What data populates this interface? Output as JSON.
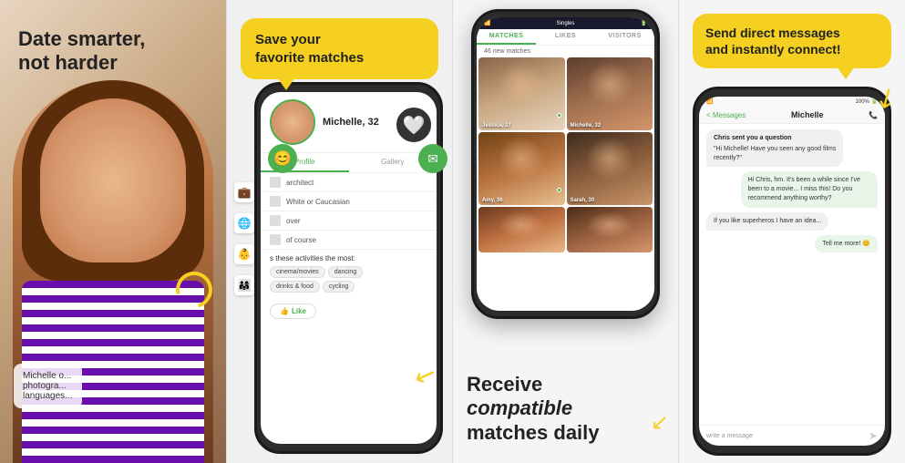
{
  "panel1": {
    "headline1": "Date smarter,",
    "headline2": "not harder",
    "info_name": "Michelle o...",
    "info_photos": "photogra...",
    "info_languages": "languages..."
  },
  "panel2": {
    "bubble_text_1": "Save your",
    "bubble_text_2": "favorite",
    "bubble_text_3": "matches",
    "profile_name": "Michelle, 32",
    "tab_profile": "Profile",
    "tab_gallery": "Gallery",
    "row1": "architect",
    "row2": "White or Caucasian",
    "row3": "over",
    "row4": "of course",
    "activities_label": "s these activities the most:",
    "tag1": "cinema/movies",
    "tag2": "dancing",
    "tag3": "drinks & food",
    "tag4": "cycling",
    "like_label": "Like"
  },
  "panel3": {
    "app_title": "Singles",
    "tab_matches": "MATCHES",
    "tab_likes": "LIKES",
    "tab_visitors": "VISITORS",
    "new_matches": "46 new matches",
    "person1_name": "Jessica, 37",
    "person2_name": "Michelle, 32",
    "person3_name": "Amy, 36",
    "person4_name": "Sarah, 30",
    "caption_line1": "Receive",
    "caption_line2": "compatible",
    "caption_line3": "matches daily"
  },
  "panel4": {
    "bubble_line1": "Send direct messages",
    "bubble_line2": "and instantly connect!",
    "back_label": "< Messages",
    "contact_name": "Michelle",
    "message1_sender": "Chris sent you a question",
    "message1_text": "\"Hi Michelle! Have you seen any good films recently?\"",
    "message2_text": "Hi Chris, hm. It's been a while since I've been to a movie... I miss this! Do you recommend anything worthy?",
    "message3_text": "If you like superheros I have an idea...",
    "message4_text": "Tell me more! 😊",
    "input_placeholder": "write a message"
  }
}
